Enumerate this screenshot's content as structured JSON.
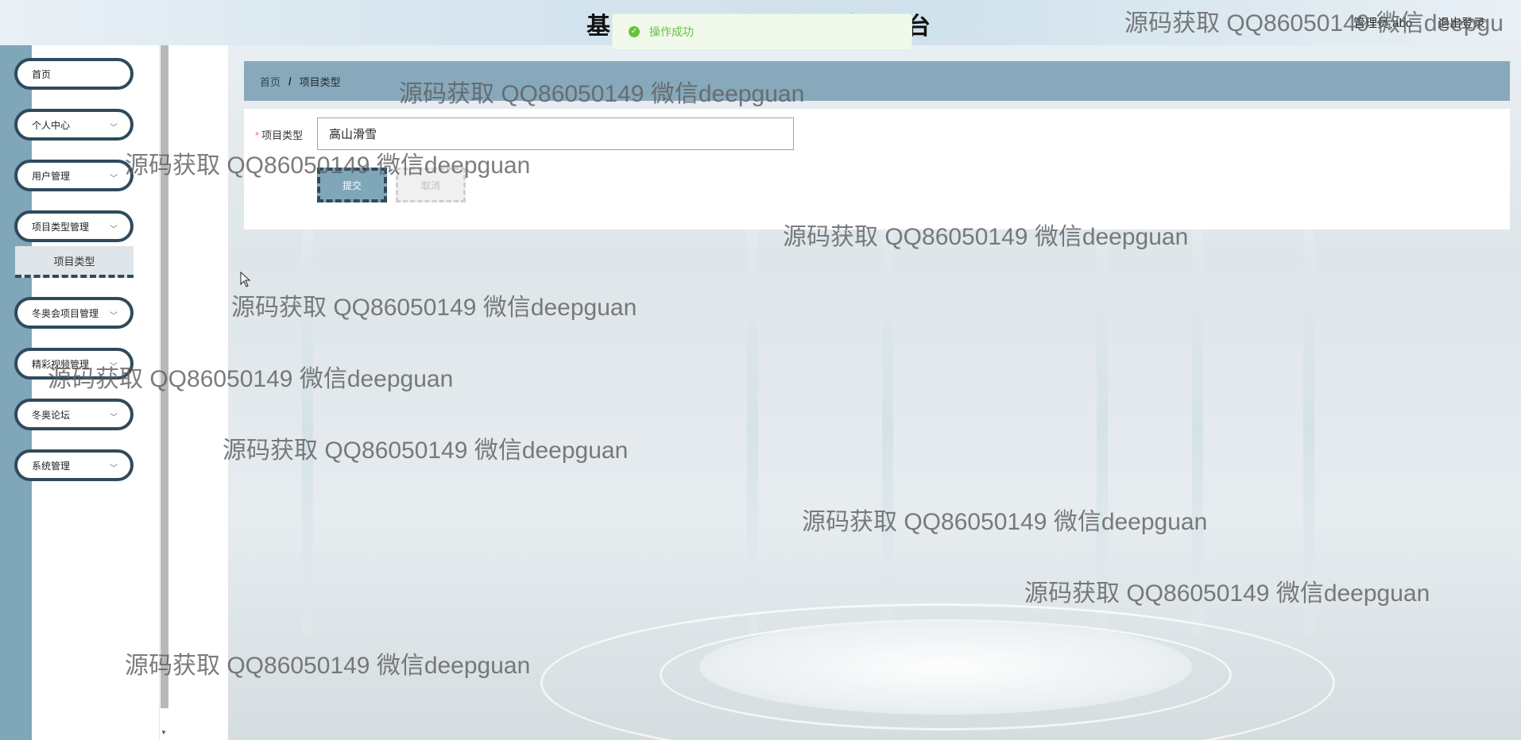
{
  "header": {
    "title": "基于　　　　的冬奥会科普平台",
    "user": "管理员 abo",
    "logout": "退出登录"
  },
  "toast": {
    "text": "操作成功",
    "icon": "success-check-icon",
    "color": "#67c23a"
  },
  "sidebar": {
    "items": [
      {
        "label": "首页",
        "has_chevron": false
      },
      {
        "label": "个人中心",
        "has_chevron": true
      },
      {
        "label": "用户管理",
        "has_chevron": true
      },
      {
        "label": "项目类型管理",
        "has_chevron": true
      },
      {
        "label": "冬奥会项目管理",
        "has_chevron": true
      },
      {
        "label": "精彩视频管理",
        "has_chevron": true
      },
      {
        "label": "冬奥论坛",
        "has_chevron": true
      },
      {
        "label": "系统管理",
        "has_chevron": true
      }
    ],
    "submenu": {
      "label": "项目类型"
    }
  },
  "breadcrumb": {
    "home": "首页",
    "separator": "/",
    "current": "项目类型"
  },
  "form": {
    "field_label": "项目类型",
    "required_mark": "*",
    "field_value": "高山滑雪",
    "submit_label": "提交",
    "cancel_label": "取消"
  },
  "watermarks": [
    "源码获取 QQ86050149 微信deepgu",
    "源码获取 QQ86050149 微信deepguan",
    "源码获取 QQ86050149 微信deepguan",
    "源码获取 QQ86050149 微信deepguan",
    "源码获取 QQ86050149 微信deepguan",
    "源码获取 QQ86050149 微信deepguan",
    "源码获取 QQ86050149 微信deepguan",
    "源码获取 QQ86050149 微信deepguan",
    "源码获取 QQ86050149 微信deepguan",
    "源码获取 QQ86050149 微信deepguan"
  ],
  "colors": {
    "accent": "#7fa6b9",
    "border_dark": "#2f4a5c",
    "breadcrumb_bg": "#87a9bb"
  }
}
